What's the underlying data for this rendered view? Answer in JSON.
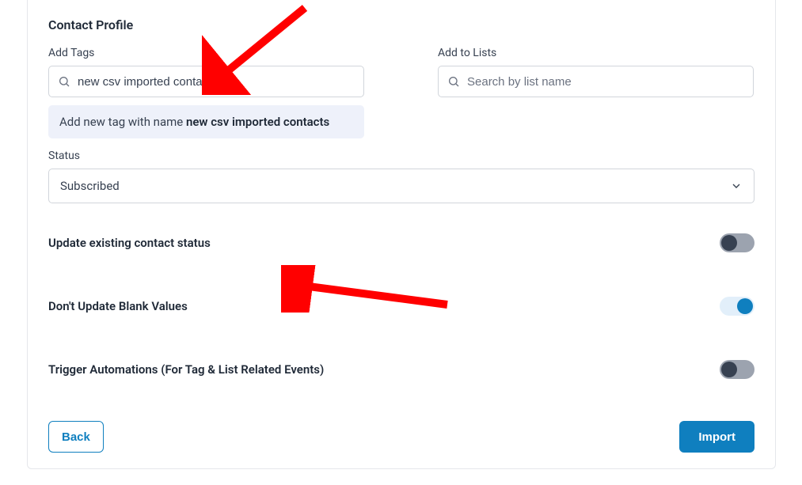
{
  "section_title": "Contact Profile",
  "tags": {
    "label": "Add Tags",
    "value": "new csv imported contacts",
    "suggestion_prefix": "Add new tag with name ",
    "suggestion_value": "new csv imported contacts"
  },
  "lists": {
    "label": "Add to Lists",
    "placeholder": "Search by list name"
  },
  "status": {
    "label": "Status",
    "selected": "Subscribed"
  },
  "toggles": {
    "update_status": {
      "label": "Update existing contact status",
      "on": false
    },
    "blank_values": {
      "label": "Don't Update Blank Values",
      "on": true
    },
    "trigger_auto": {
      "label": "Trigger Automations (For Tag & List Related Events)",
      "on": false
    }
  },
  "buttons": {
    "back": "Back",
    "import": "Import"
  }
}
